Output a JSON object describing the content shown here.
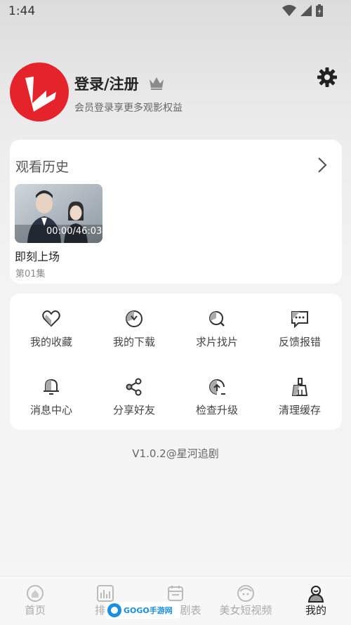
{
  "status": {
    "time": "1:44"
  },
  "header": {
    "title": "登录/注册",
    "subtitle": "会员登录享更多观影权益"
  },
  "history": {
    "title": "观看历史",
    "item": {
      "time": "00:00/46:03",
      "name": "即刻上场",
      "episode": "第01集"
    }
  },
  "functions": [
    {
      "label": "我的收藏",
      "icon": "heart-icon"
    },
    {
      "label": "我的下载",
      "icon": "download-icon"
    },
    {
      "label": "求片找片",
      "icon": "search-icon"
    },
    {
      "label": "反馈报错",
      "icon": "feedback-icon"
    },
    {
      "label": "消息中心",
      "icon": "bell-icon"
    },
    {
      "label": "分享好友",
      "icon": "share-icon"
    },
    {
      "label": "检查升级",
      "icon": "upgrade-icon"
    },
    {
      "label": "清理缓存",
      "icon": "broom-icon"
    }
  ],
  "version": "V1.0.2@星河追剧",
  "nav": [
    {
      "label": "首页",
      "active": false
    },
    {
      "label": "排行",
      "active": false
    },
    {
      "label": "追剧表",
      "active": false
    },
    {
      "label": "美女短视频",
      "active": false
    },
    {
      "label": "我的",
      "active": true
    }
  ],
  "watermark": {
    "text": "GOGO手游网"
  },
  "colors": {
    "brand_red": "#e5232b",
    "card_bg": "#ffffff",
    "text_dark": "#222222",
    "text_muted": "#888888"
  }
}
